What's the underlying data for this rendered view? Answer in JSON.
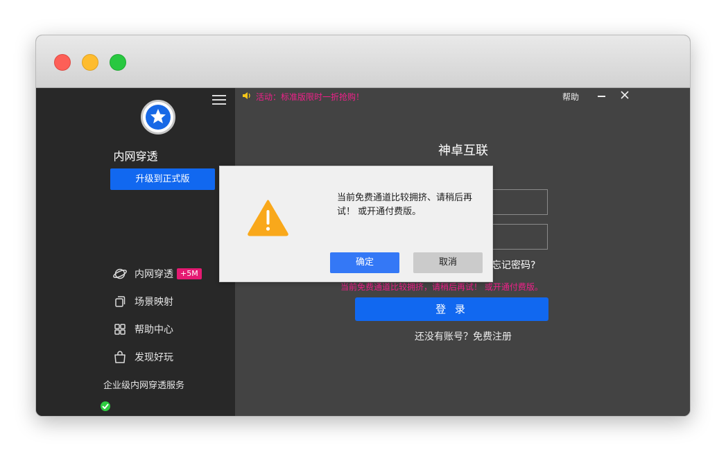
{
  "window": {
    "controls": [
      "close",
      "minimize",
      "zoom"
    ]
  },
  "sidebar": {
    "app_name": "内网穿透",
    "upgrade_label": "升级到正式版",
    "nav_items": [
      {
        "label": "内网穿透",
        "icon": "planet-icon",
        "badge": "+5M"
      },
      {
        "label": "场景映射",
        "icon": "copy-icon"
      },
      {
        "label": "帮助中心",
        "icon": "grid-icon"
      },
      {
        "label": "发现好玩",
        "icon": "shopping-bag-icon"
      }
    ],
    "footer_text": "企业级内网穿透服务",
    "status_icon": "check-circle-icon"
  },
  "main": {
    "notice": "活动：标准版限时一折抢购！",
    "help_label": "帮助",
    "brand_title": "神卓互联",
    "forgot_password": "忘记密码?",
    "error_message": "当前免费通道比较拥挤，请稍后再试！ 或开通付费版。",
    "login_label": "登 录",
    "register_text": "还没有账号？免费注册"
  },
  "dialog": {
    "icon": "warning-icon",
    "message": "当前免费通道比较拥挤、请稍后再试！ 或开通付费版。",
    "ok_label": "确定",
    "cancel_label": "取消"
  },
  "colors": {
    "accent": "#1168f0",
    "badge": "#e51a72",
    "notice": "#f0208a",
    "warning": "#f9a81b",
    "sidebar_bg": "#282828",
    "main_bg": "#434343"
  }
}
